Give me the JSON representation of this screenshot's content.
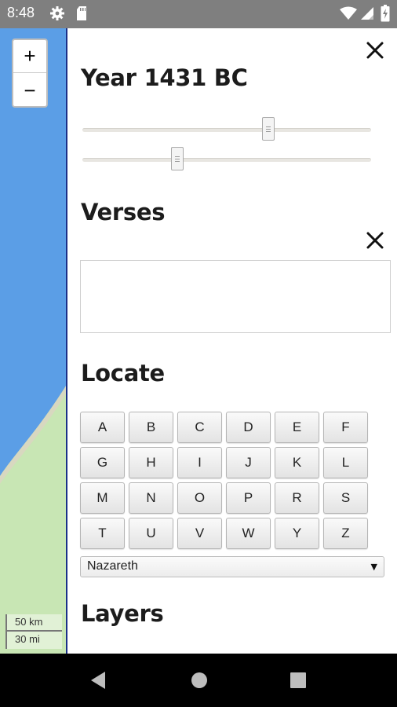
{
  "status_bar": {
    "time": "8:48",
    "icons": [
      "settings-gear-icon",
      "sd-card-icon",
      "wifi-icon",
      "cell-signal-icon",
      "battery-icon"
    ]
  },
  "map": {
    "zoom_in_label": "+",
    "zoom_out_label": "−",
    "scale_km": "50 km",
    "scale_mi": "30 mi",
    "colors": {
      "sea": "#5b9ee6",
      "land": "#c8e6b4",
      "shore": "#d8d8c0"
    }
  },
  "panel": {
    "year_title": "Year 1431 BC",
    "year_slider_value": 0.65,
    "range_slider_value": 0.32,
    "verses_title": "Verses",
    "verses_text": "",
    "locate_title": "Locate",
    "letters": [
      "A",
      "B",
      "C",
      "D",
      "E",
      "F",
      "G",
      "H",
      "I",
      "J",
      "K",
      "L",
      "M",
      "N",
      "O",
      "P",
      "R",
      "S",
      "T",
      "U",
      "V",
      "W",
      "Y",
      "Z"
    ],
    "selected_place": "Nazareth",
    "layers_title": "Layers",
    "accent_border": "#1a2f88"
  },
  "nav_bar": {
    "buttons": [
      "back-icon",
      "home-icon",
      "recents-icon"
    ]
  }
}
